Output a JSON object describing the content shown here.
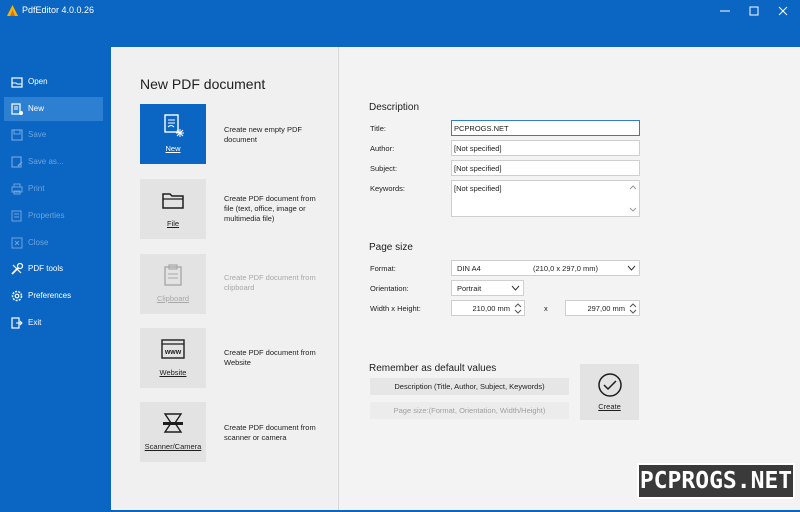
{
  "window": {
    "title": "PdfEditor 4.0.0.26",
    "accent_color": "#0a66c2"
  },
  "sidebar": {
    "items": [
      {
        "label": "Open",
        "icon": "open-icon",
        "state": "enabled"
      },
      {
        "label": "New",
        "icon": "new-icon",
        "state": "active"
      },
      {
        "label": "Save",
        "icon": "save-icon",
        "state": "disabled"
      },
      {
        "label": "Save as...",
        "icon": "save-as-icon",
        "state": "disabled"
      },
      {
        "label": "Print",
        "icon": "print-icon",
        "state": "disabled"
      },
      {
        "label": "Properties",
        "icon": "properties-icon",
        "state": "disabled"
      },
      {
        "label": "Close",
        "icon": "close-icon",
        "state": "disabled"
      },
      {
        "label": "PDF tools",
        "icon": "tools-icon",
        "state": "enabled"
      },
      {
        "label": "Preferences",
        "icon": "gear-icon",
        "state": "enabled"
      },
      {
        "label": "Exit",
        "icon": "exit-icon",
        "state": "enabled"
      }
    ]
  },
  "main": {
    "page_title": "New PDF document",
    "sources": [
      {
        "label": "New",
        "description": "Create new empty PDF document",
        "icon": "new-document-icon",
        "state": "selected"
      },
      {
        "label": "File",
        "description": "Create PDF document from file (text, office, image or multimedia file)",
        "icon": "folder-icon",
        "state": "enabled"
      },
      {
        "label": "Clipboard",
        "description": "Create PDF document from clipboard",
        "icon": "clipboard-icon",
        "state": "disabled"
      },
      {
        "label": "Website",
        "description": "Create PDF document from Website",
        "icon": "website-icon",
        "state": "enabled"
      },
      {
        "label": "Scanner/Camera",
        "description": "Create PDF document from scanner or camera",
        "icon": "scanner-icon",
        "state": "enabled"
      }
    ],
    "description": {
      "heading": "Description",
      "title_label": "Title:",
      "title_value": "PCPROGS.NET",
      "author_label": "Author:",
      "author_value": "[Not specified]",
      "subject_label": "Subject:",
      "subject_value": "[Not specified]",
      "keywords_label": "Keywords:",
      "keywords_value": "[Not specified]"
    },
    "page_size": {
      "heading": "Page size",
      "format_label": "Format:",
      "format_value": "DIN A4",
      "format_dims": "(210,0 x 297,0 mm)",
      "orientation_label": "Orientation:",
      "orientation_value": "Portrait",
      "wh_label": "Width x Height:",
      "width_value": "210,00 mm",
      "x_sep": "x",
      "height_value": "297,00 mm"
    },
    "remember": {
      "heading": "Remember as default values",
      "description_button": "Description (Title, Author, Subject, Keywords)",
      "pagesize_button": "Page size:(Format, Orientation, Width/Height)"
    },
    "create_button": "Create"
  },
  "watermark": "PCPROGS.NET"
}
